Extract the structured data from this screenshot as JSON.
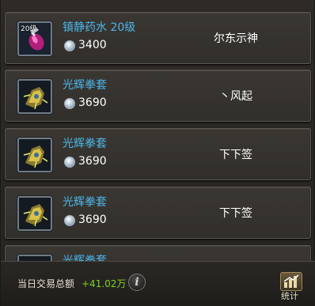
{
  "header": {
    "col_partial_left": "—",
    "col_partial_right": "——"
  },
  "rows": [
    {
      "item_name": "镇静药水 20级",
      "level_badge": "20级",
      "price": "3400",
      "seller": "尔东示神",
      "icon": "potion-icon"
    },
    {
      "item_name": "光辉拳套",
      "price": "3690",
      "seller": "丶风起",
      "icon": "gauntlet-icon"
    },
    {
      "item_name": "光辉拳套",
      "price": "3690",
      "seller": "下下签",
      "icon": "gauntlet-icon"
    },
    {
      "item_name": "光辉拳套",
      "price": "3690",
      "seller": "下下签",
      "icon": "gauntlet-icon"
    },
    {
      "item_name": "光辉拳套",
      "price": "",
      "seller": "",
      "icon": "gauntlet-icon"
    }
  ],
  "footer": {
    "label": "当日交易总额",
    "value": "+41.02万",
    "info_icon": "i",
    "stats_label": "统计"
  },
  "colors": {
    "item_name": "#4cb7ea",
    "value_green": "#7ed321"
  }
}
